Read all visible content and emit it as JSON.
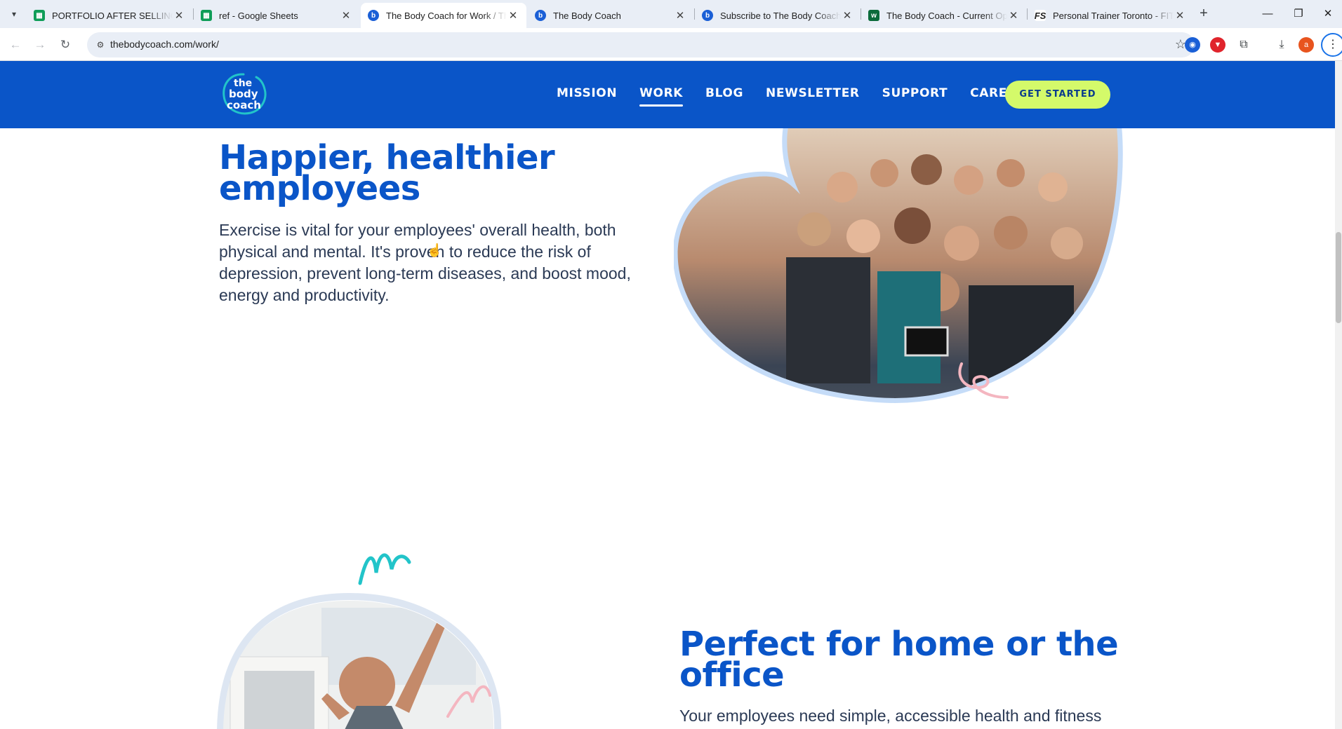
{
  "browser": {
    "tabs": [
      {
        "title": "PORTFOLIO AFTER SELLING - G",
        "icon": "sheets-icon"
      },
      {
        "title": "ref - Google Sheets",
        "icon": "sheets-icon"
      },
      {
        "title": "The Body Coach for Work / The",
        "icon": "body-coach-icon"
      },
      {
        "title": "The Body Coach",
        "icon": "body-coach-icon"
      },
      {
        "title": "Subscribe to The Body Coach",
        "icon": "body-coach-icon"
      },
      {
        "title": "The Body Coach - Current Ope",
        "icon": "workable-icon"
      },
      {
        "title": "Personal Trainer Toronto - FIT S",
        "icon": "fs-icon"
      }
    ],
    "active_tab_index": 2,
    "close_glyph": "✕",
    "new_tab_glyph": "+",
    "url": "thebodycoach.com/work/",
    "extension_avatar_letter": "a"
  },
  "site": {
    "logo_text": [
      "the",
      "body",
      "coach"
    ],
    "nav": {
      "items": [
        "MISSION",
        "WORK",
        "BLOG",
        "NEWSLETTER",
        "SUPPORT",
        "CAREERS"
      ],
      "current": "WORK",
      "cta": "GET STARTED"
    },
    "section1": {
      "heading_line1": "Happier, healthier",
      "heading_line2": "employees",
      "body_line1": "Exercise is vital for your employees' overall health, both",
      "body_line2": "physical and mental. It's proven to reduce the risk of",
      "body_line3": "depression, prevent long-term diseases, and boost mood,",
      "body_line4": "energy and productivity."
    },
    "section2": {
      "heading_line1": "Perfect for home or the",
      "heading_line2": "office",
      "body_line1": "Your employees need simple, accessible health and fitness"
    },
    "colors": {
      "brand_blue": "#0a55c8",
      "cta_lime": "#d4fa6a",
      "blob_outline": "#c5dcf8",
      "squiggle_teal": "#22c4c9",
      "squiggle_pink": "#f4b6c0"
    }
  }
}
